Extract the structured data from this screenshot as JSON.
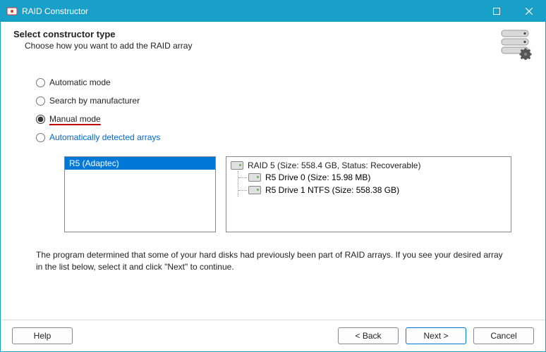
{
  "window": {
    "title": "RAID Constructor"
  },
  "header": {
    "title": "Select constructor type",
    "subtitle": "Choose how you want to add the RAID array"
  },
  "options": {
    "automatic": "Automatic mode",
    "manufacturer": "Search by manufacturer",
    "manual": "Manual mode",
    "detected": "Automatically detected arrays"
  },
  "left_panel": {
    "selected": "R5 (Adaptec)"
  },
  "tree": {
    "root": "RAID 5 (Size: 558.4 GB, Status: Recoverable)",
    "child0": "R5 Drive 0 (Size: 15.98 MB)",
    "child1": "R5 Drive 1 NTFS (Size: 558.38 GB)"
  },
  "description": "The program determined that some of your hard disks had previously been part of RAID arrays. If you see your desired array in the list below, select it and click \"Next\" to continue.",
  "buttons": {
    "help": "Help",
    "back": "< Back",
    "next": "Next >",
    "cancel": "Cancel"
  }
}
